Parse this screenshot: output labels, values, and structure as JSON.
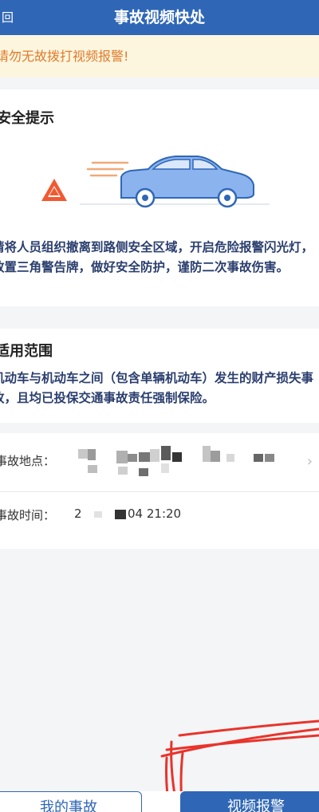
{
  "header": {
    "back_label": "回",
    "title": "事故视频快处"
  },
  "warning": {
    "text": "请勿无故拨打视频报警!"
  },
  "safety": {
    "title": "安全提示",
    "text": "请将人员组织撤离到路侧安全区域，开启危险报警闪光灯，放置三角警告牌，做好安全防护，谨防二次事故伤害。"
  },
  "scope": {
    "title": "适用范围",
    "text": "机动车与机动车之间（包含单辆机动车）发生的财产损失事故，且均已投保交通事故责任强制保险。"
  },
  "info": {
    "location_label": "事故地点：",
    "time_label": "事故时间：",
    "time_prefix": "2",
    "time_value": "04 21:20"
  },
  "bottom": {
    "mine_label": "我的事故",
    "video_label": "视频报警"
  },
  "colors": {
    "primary": "#2f67b6",
    "warning_text": "#e07b2c",
    "warning_bg": "#fdf6df",
    "annotation": "#e8342b"
  },
  "icons": {
    "warning_triangle": "warning-triangle-icon",
    "car": "car-icon",
    "chevron": "chevron-right-icon"
  }
}
